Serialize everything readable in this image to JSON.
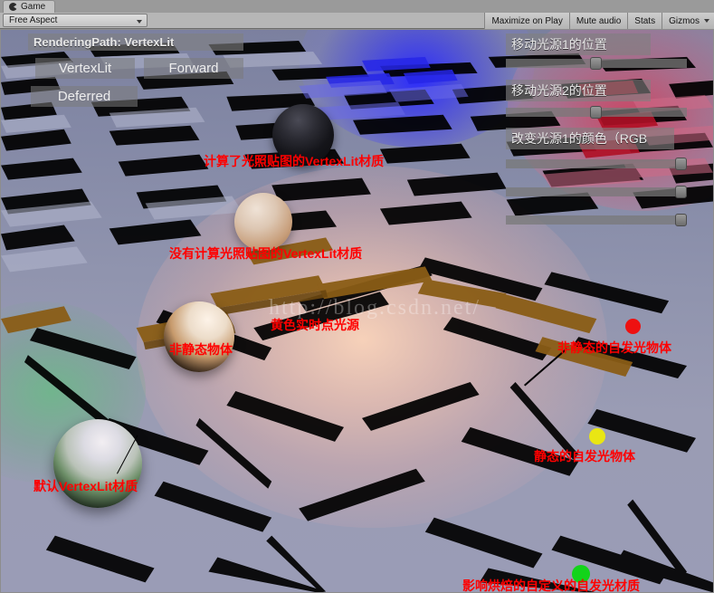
{
  "window": {
    "tab_label": "Game",
    "tab_icon": "unity-logo-icon"
  },
  "toolbar": {
    "aspect_value": "Free Aspect",
    "aspect_caret": "chevron-down-icon",
    "buttons": [
      {
        "label": "Maximize on Play"
      },
      {
        "label": "Mute audio"
      },
      {
        "label": "Stats"
      },
      {
        "label": "Gizmos"
      }
    ],
    "gizmos_caret": "chevron-down-icon"
  },
  "game_gui": {
    "rendering_path_label": "RenderingPath: VertexLit",
    "path_buttons": [
      {
        "label": "VertexLit"
      },
      {
        "label": "Forward"
      },
      {
        "label": "Deferred"
      }
    ],
    "light1_pos_label": "移动光源1的位置",
    "light2_pos_label": "移动光源2的位置",
    "light1_color_label": "改变光源1的颜色（RGB",
    "sliders": [
      {
        "name": "light1-position-slider",
        "value_pct": 50
      },
      {
        "name": "light2-position-slider",
        "value_pct": 50
      },
      {
        "name": "light1-red-slider",
        "value_pct": 100
      },
      {
        "name": "light1-green-slider",
        "value_pct": 100
      },
      {
        "name": "light1-blue-slider",
        "value_pct": 100
      }
    ]
  },
  "annotations": [
    {
      "name": "anno-lightmapped-vertexlit",
      "text": "计算了光照贴图的VertexLit材质"
    },
    {
      "name": "anno-non-lightmapped-vertexlit",
      "text": "没有计算光照贴图的VertexLit材质"
    },
    {
      "name": "anno-yellow-realtime-point-light",
      "text": "黄色实时点光源"
    },
    {
      "name": "anno-non-static-object",
      "text": "非静态物体"
    },
    {
      "name": "anno-non-static-emissive-object",
      "text": "非静态的自发光物体"
    },
    {
      "name": "anno-static-emissive-object",
      "text": "静态的自发光物体"
    },
    {
      "name": "anno-default-vertexlit-material",
      "text": "默认VertexLit材质"
    },
    {
      "name": "anno-custom-emissive-material",
      "text": "影响烘焙的自定义的自发光材质"
    }
  ],
  "markers": [
    {
      "name": "marker-red-dot",
      "color": "#ee1111"
    },
    {
      "name": "marker-yellow-dot",
      "color": "#e9e614"
    },
    {
      "name": "marker-green-dot",
      "color": "#12d41a"
    }
  ],
  "watermark": {
    "text": "http://blog.csdn.net/"
  },
  "colors": {
    "annotation_red": "#ff0000",
    "floor_base": "#8b8fad",
    "blue_light": "#1a1ae0",
    "red_light": "#c01030",
    "warm_light": "#e8a878",
    "green_light": "#2fa04a",
    "gui_panel": "rgba(128,128,128,0.62)"
  }
}
